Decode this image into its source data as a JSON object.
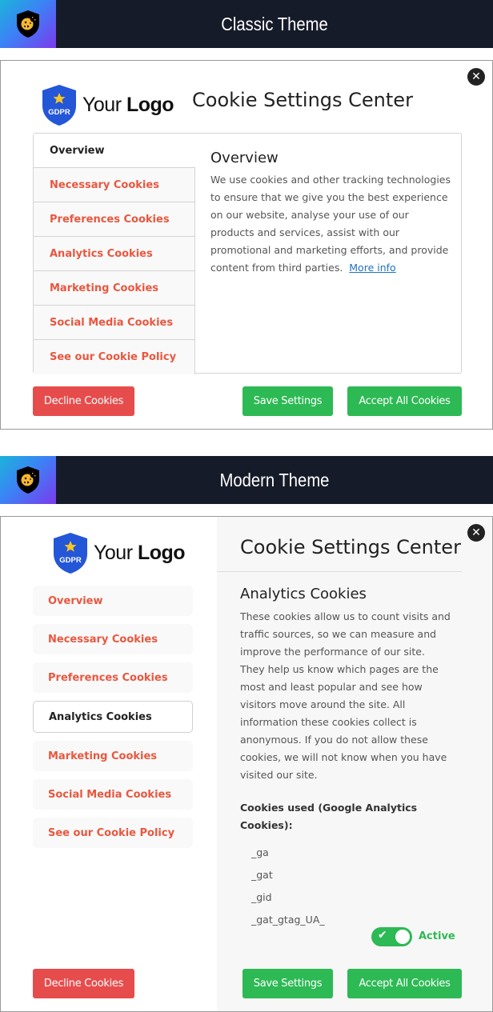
{
  "classic": {
    "banner_title": "Classic Theme",
    "logo": {
      "badge_text": "GDPR",
      "your": "Your",
      "logo": "Logo"
    },
    "heading": "Cookie Settings Center",
    "close_icon": "✕",
    "nav": [
      {
        "label": "Overview",
        "active": true
      },
      {
        "label": "Necessary Cookies",
        "active": false
      },
      {
        "label": "Preferences Cookies",
        "active": false
      },
      {
        "label": "Analytics Cookies",
        "active": false
      },
      {
        "label": "Marketing Cookies",
        "active": false
      },
      {
        "label": "Social Media Cookies",
        "active": false
      },
      {
        "label": "See our Cookie Policy",
        "active": false
      }
    ],
    "content": {
      "title": "Overview",
      "text": "We use cookies and other tracking technologies to ensure that we give you the best experience on our website, analyse your use of our products and services, assist with our promotional and marketing efforts, and provide content from third parties.",
      "more_info": "More info"
    },
    "buttons": {
      "decline": "Decline Cookies",
      "save": "Save Settings",
      "accept": "Accept All Cookies"
    }
  },
  "modern": {
    "banner_title": "Modern Theme",
    "logo": {
      "badge_text": "GDPR",
      "your": "Your",
      "logo": "Logo"
    },
    "heading": "Cookie Settings Center",
    "close_icon": "✕",
    "nav": [
      {
        "label": "Overview",
        "active": false
      },
      {
        "label": "Necessary Cookies",
        "active": false
      },
      {
        "label": "Preferences Cookies",
        "active": false
      },
      {
        "label": "Analytics Cookies",
        "active": true
      },
      {
        "label": "Marketing Cookies",
        "active": false
      },
      {
        "label": "Social Media Cookies",
        "active": false
      },
      {
        "label": "See our Cookie Policy",
        "active": false
      }
    ],
    "content": {
      "title": "Analytics Cookies",
      "text": "These cookies allow us to count visits and traffic sources, so we can measure and improve the performance of our site. They help us know which pages are the most and least popular and see how visitors move around the site. All information these cookies collect is anonymous. If you do not allow these cookies, we will not know when you have visited our site.",
      "cookies_used_label": "Cookies used (Google Analytics Cookies):",
      "cookies": [
        "_ga",
        "_gat",
        "_gid",
        "_gat_gtag_UA_"
      ],
      "toggle_state": "Active",
      "toggle_on": true
    },
    "buttons": {
      "decline": "Decline Cookies",
      "save": "Save Settings",
      "accept": "Accept All Cookies"
    }
  },
  "colors": {
    "accent": "#e9573f",
    "decline": "#e74c4c",
    "accept": "#2db954",
    "banner_bg": "#161b29",
    "link": "#1e73be"
  }
}
